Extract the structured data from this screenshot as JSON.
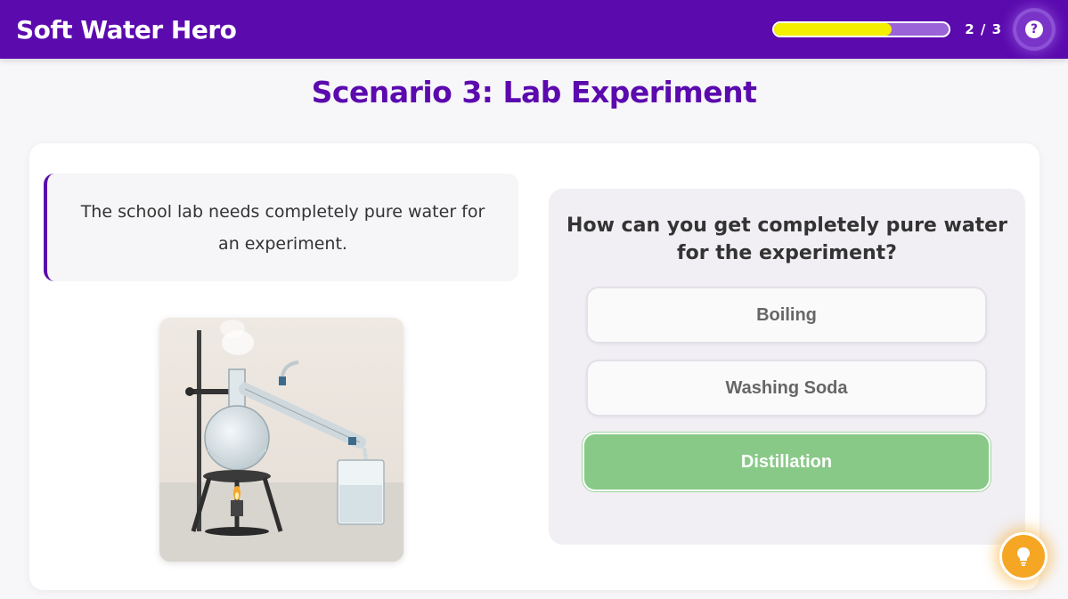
{
  "app": {
    "title": "Soft Water Hero"
  },
  "progress": {
    "text": "2 / 3",
    "fraction": 0.67
  },
  "scenario": {
    "title": "Scenario 3: Lab Experiment",
    "description": "The school lab needs completely pure water for an experiment."
  },
  "question": {
    "text": "How can you get completely pure water for the experiment?",
    "options": [
      {
        "label": "Boiling",
        "state": "default"
      },
      {
        "label": "Washing Soda",
        "state": "default"
      },
      {
        "label": "Distillation",
        "state": "correct"
      }
    ]
  },
  "icons": {
    "help": "question-mark-icon",
    "hint": "lightbulb-icon"
  },
  "colors": {
    "header": "#5b0aae",
    "accent": "#5b0aae",
    "progress_fill": "#f4ef00",
    "correct": "#88c988",
    "hint": "#f5a623"
  }
}
